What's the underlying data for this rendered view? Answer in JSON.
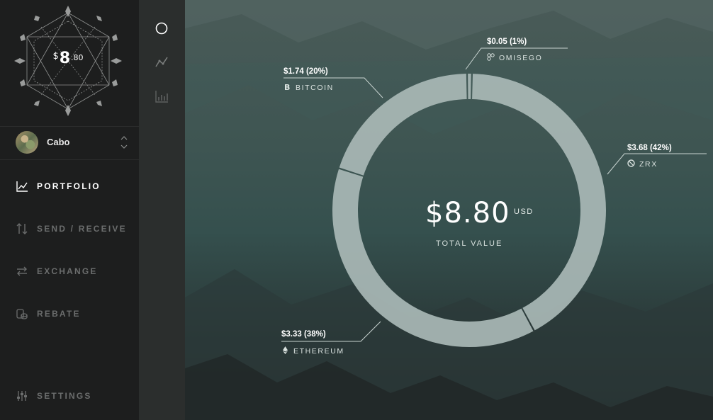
{
  "logo": {
    "currency_symbol": "$",
    "value_int": "8",
    "value_dec": ".80"
  },
  "account": {
    "name": "Cabo"
  },
  "nav": [
    {
      "label": "PORTFOLIO",
      "icon": "line-chart-icon",
      "active": true
    },
    {
      "label": "SEND / RECEIVE",
      "icon": "transfer-icon",
      "active": false
    },
    {
      "label": "EXCHANGE",
      "icon": "exchange-icon",
      "active": false
    },
    {
      "label": "REBATE",
      "icon": "coins-icon",
      "active": false
    },
    {
      "label": "SETTINGS",
      "icon": "sliders-icon",
      "active": false
    }
  ],
  "strip": [
    "donut-view-icon",
    "line-view-icon",
    "bar-view-icon"
  ],
  "total": {
    "value": "$8.80",
    "currency": "USD",
    "label": "TOTAL VALUE"
  },
  "chart_data": {
    "type": "pie",
    "donut": true,
    "categories": [
      "ZRX",
      "ETHEREUM",
      "BITCOIN",
      "OMISEGO"
    ],
    "values": [
      3.68,
      3.33,
      1.74,
      0.05
    ],
    "percentages": [
      42,
      38,
      20,
      1
    ],
    "labels": [
      "$3.68 (42%)",
      "$3.33 (38%)",
      "$1.74 (20%)",
      "$0.05 (1%)"
    ],
    "colors": {
      "ring": "#a9b9b6"
    }
  },
  "callouts": {
    "omisego": {
      "value": "$0.05 (1%)",
      "name": "OMISEGO"
    },
    "bitcoin": {
      "value": "$1.74 (20%)",
      "name": "BITCOIN"
    },
    "zrx": {
      "value": "$3.68 (42%)",
      "name": "ZRX"
    },
    "ethereum": {
      "value": "$3.33 (38%)",
      "name": "ETHEREUM"
    }
  }
}
